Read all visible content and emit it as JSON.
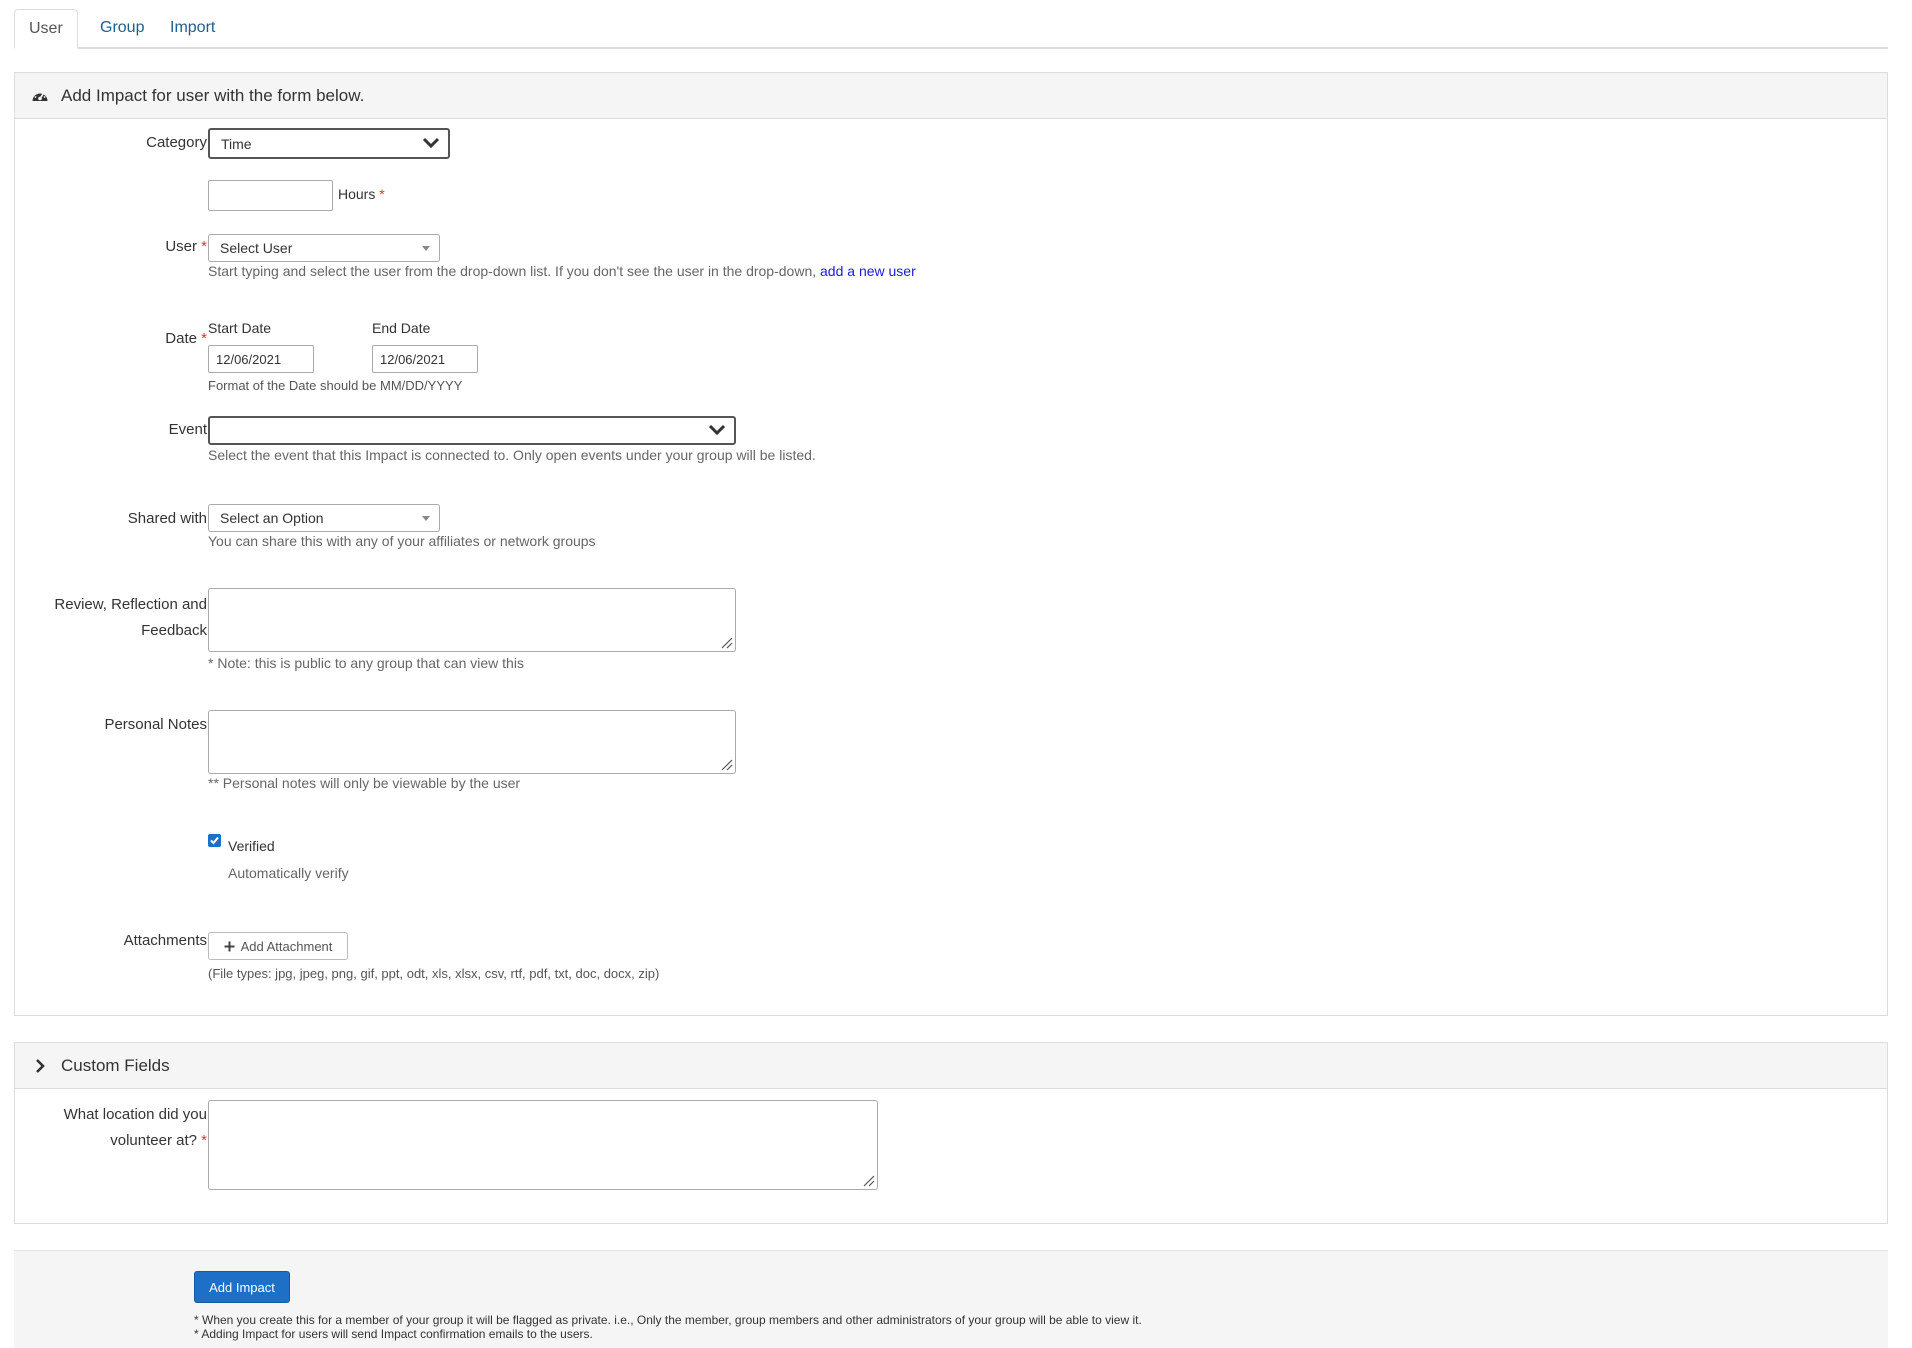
{
  "tabs": [
    "User",
    "Group",
    "Import"
  ],
  "form_panel": {
    "title": "Add Impact for user with the form below.",
    "icon": "dashboard-icon"
  },
  "fields": {
    "category": {
      "label": "Category",
      "value": "Time"
    },
    "hours": {
      "value": "",
      "label": "Hours",
      "required_mark": "*"
    },
    "user": {
      "label": "User",
      "required_mark": "*",
      "placeholder": "Select User",
      "help": "Start typing and select the user from the drop-down list. If you don't see the user in the drop-down,",
      "help_link": "add a new user"
    },
    "date": {
      "label": "Date",
      "required_mark": "*",
      "start_label": "Start Date",
      "start_value": "12/06/2021",
      "end_label": "End Date",
      "end_value": "12/06/2021",
      "help": "Format of the Date should be MM/DD/YYYY"
    },
    "event": {
      "label": "Event",
      "value": "",
      "help": "Select the event that this Impact is connected to. Only open events under your group will be listed."
    },
    "shared_with": {
      "label": "Shared with",
      "placeholder": "Select an Option",
      "help": "You can share this with any of your affiliates or network groups"
    },
    "review": {
      "label_line1": "Review, Reflection and",
      "label_line2": "Feedback",
      "help": "* Note: this is public to any group that can view this"
    },
    "personal_notes": {
      "label": "Personal Notes",
      "help": "** Personal notes will only be viewable by the user"
    },
    "verified": {
      "checked": true,
      "label": "Verified",
      "help": "Automatically verify"
    },
    "attachments": {
      "label": "Attachments",
      "button": "Add Attachment",
      "help": "(File types: jpg, jpeg, png, gif, ppt, odt, xls, xlsx, csv, rtf, pdf, txt, doc, docx, zip)"
    }
  },
  "custom_fields": {
    "title": "Custom Fields",
    "location": {
      "label_line1": "What location did you",
      "label_line2": "volunteer at?",
      "required_mark": "*"
    }
  },
  "footer": {
    "submit": "Add Impact",
    "note1": "* When you create this for a member of your group it will be flagged as private. i.e., Only the member, group members and other administrators of your group will be able to view it.",
    "note2": "* Adding Impact for users will send Impact confirmation emails to the users."
  },
  "colors": {
    "link": "#1f5f8b",
    "primary_button": "#1e6fc6",
    "required": "#d9342b"
  }
}
